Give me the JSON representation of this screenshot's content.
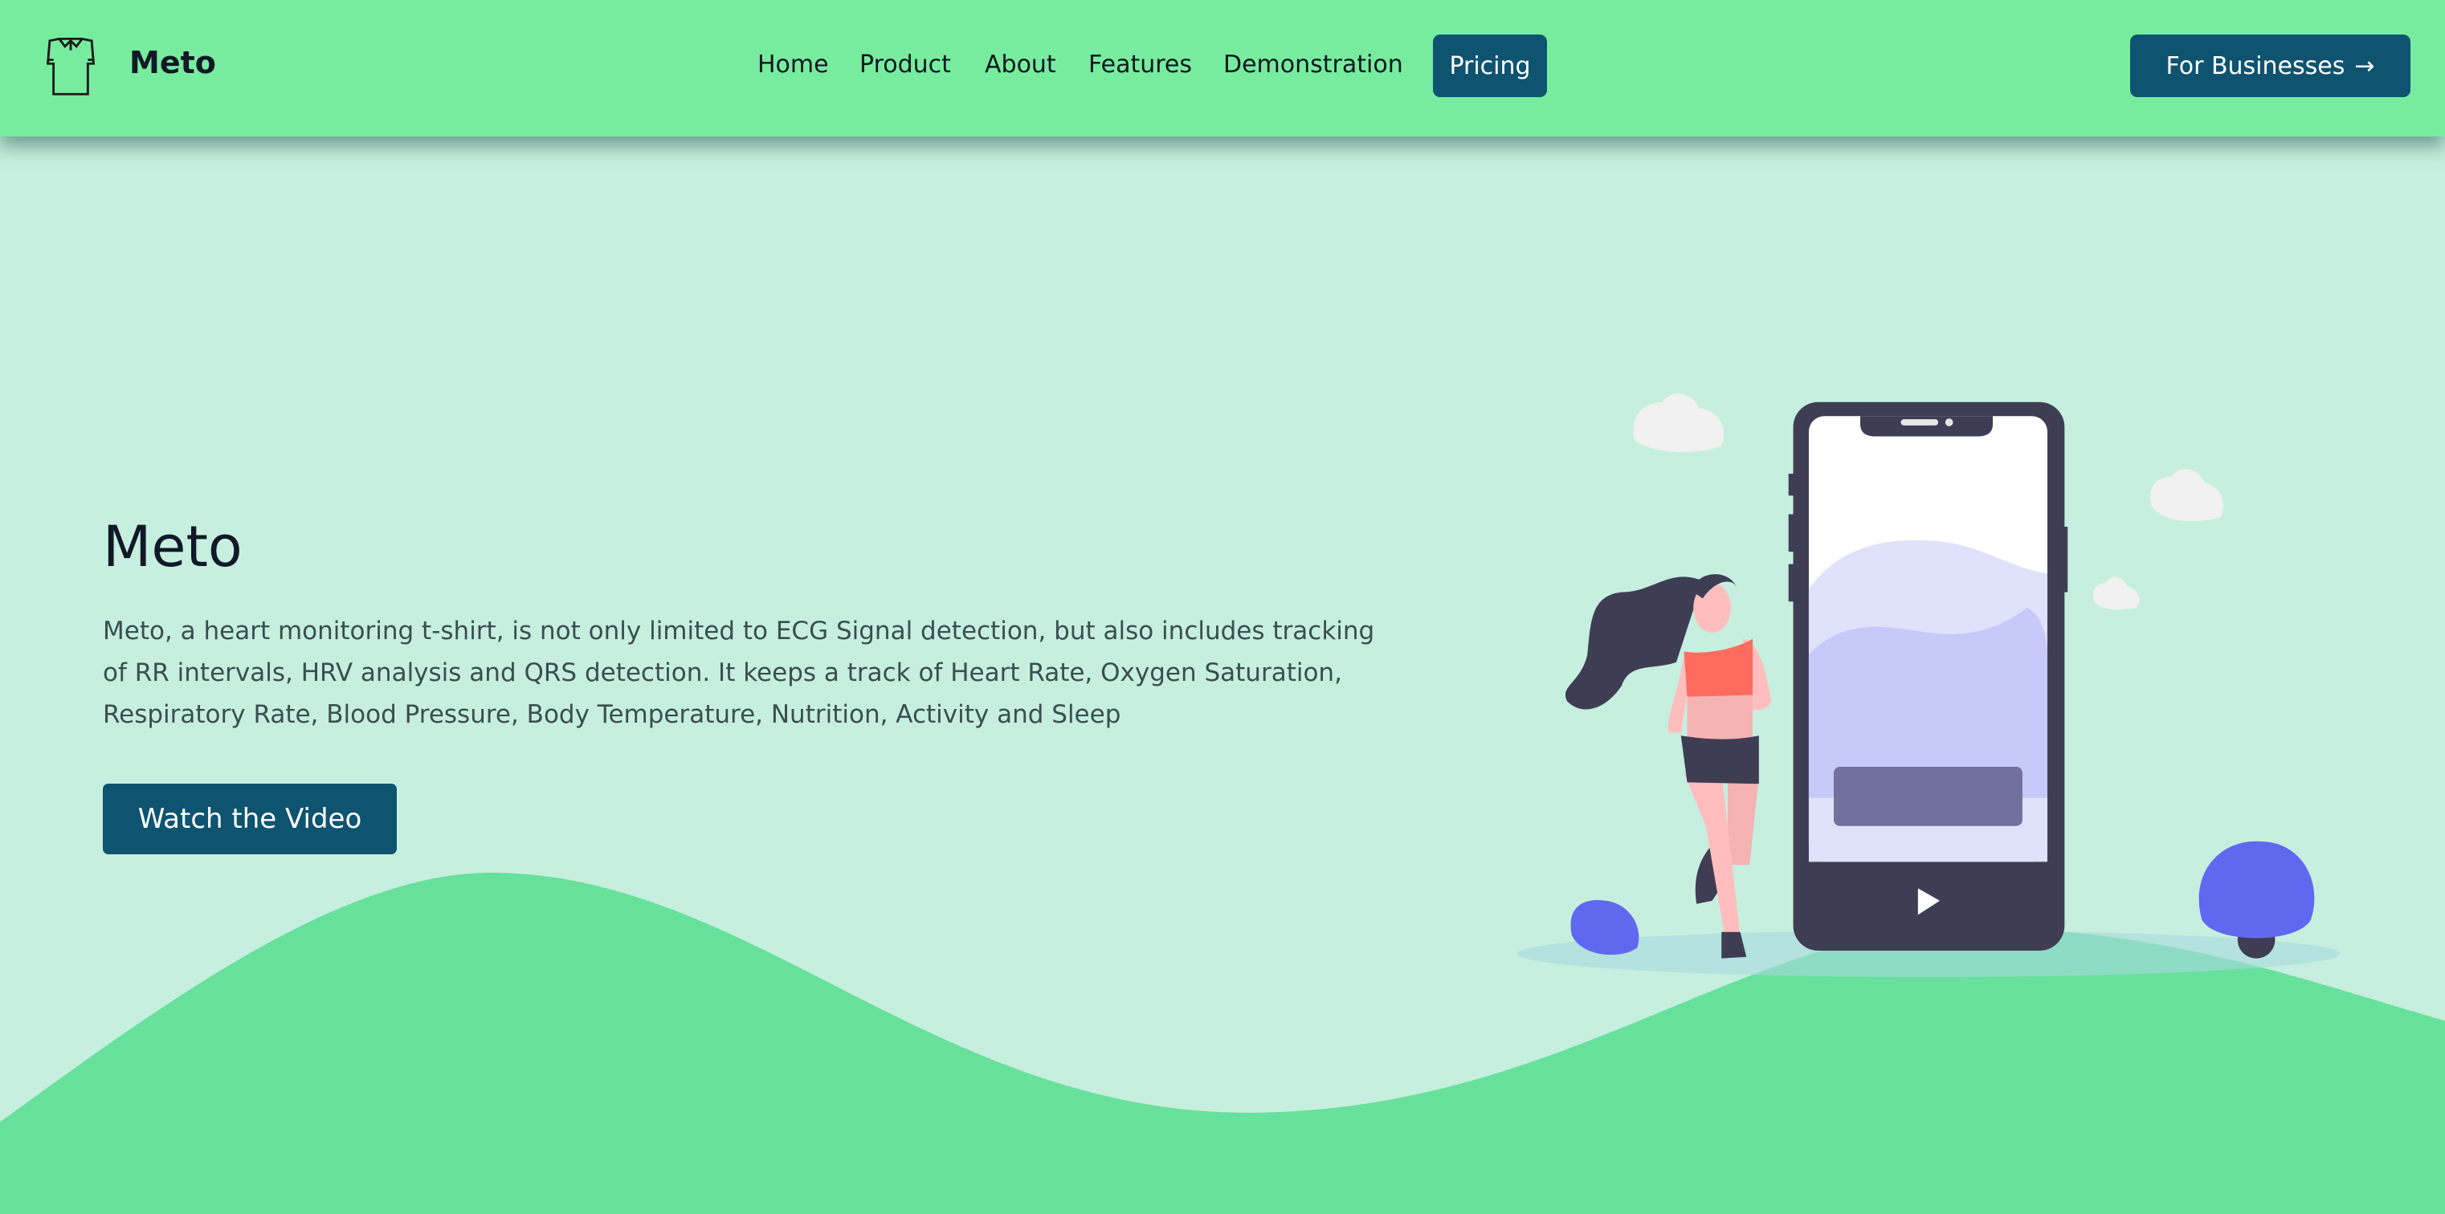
{
  "navbar": {
    "brand": "Meto",
    "logo_icon": "polo-shirt-icon",
    "links": [
      "Home",
      "Product",
      "About",
      "Features",
      "Demonstration"
    ],
    "active_link": "Pricing",
    "cta_label": "For Businesses",
    "cta_icon": "arrow-right-icon"
  },
  "hero": {
    "title": "Meto",
    "description": "Meto, a heart monitoring t-shirt, is not only limited to ECG Signal detection, but also includes tracking of RR intervals, HRV analysis and QRS detection. It keeps a track of Heart Rate, Oxygen Saturation, Respiratory Rate, Blood Pressure, Body Temperature, Nutrition, Activity and Sleep",
    "button_label": "Watch the Video"
  },
  "colors": {
    "navbar": "#77ec9f",
    "background": "#c6efdf",
    "hill": "#67e19b",
    "primary": "#0e5470",
    "phone": "#3e3d53",
    "accent": "#6168f0"
  }
}
